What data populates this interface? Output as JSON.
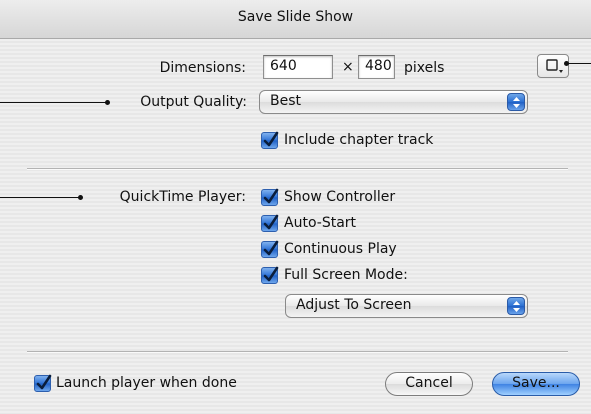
{
  "window": {
    "title": "Save Slide Show"
  },
  "dimensions": {
    "label": "Dimensions:",
    "width_value": "640",
    "separator": "×",
    "height_value": "480",
    "unit": "pixels"
  },
  "output_quality": {
    "label": "Output Quality:",
    "selected": "Best",
    "include_chapter_track": {
      "label": "Include chapter track",
      "checked": true
    }
  },
  "quicktime_player": {
    "label": "QuickTime Player:",
    "options": [
      {
        "label": "Show Controller",
        "checked": true
      },
      {
        "label": "Auto-Start",
        "checked": true
      },
      {
        "label": "Continuous Play",
        "checked": true
      },
      {
        "label": "Full Screen Mode:",
        "checked": true
      }
    ],
    "full_screen_mode_selected": "Adjust To Screen"
  },
  "footer": {
    "launch_player": {
      "label": "Launch player when done",
      "checked": true
    },
    "cancel_label": "Cancel",
    "save_label": "Save..."
  },
  "colors": {
    "accent": "#3f83e3",
    "window_bg": "#ececec"
  },
  "icons": [
    "dimensions-presets-icon",
    "popup-arrows-icon",
    "checkmark-icon"
  ]
}
